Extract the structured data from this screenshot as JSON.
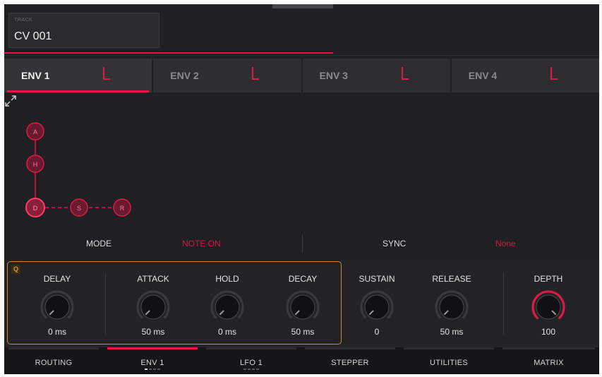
{
  "track": {
    "label": "TRACK",
    "name": "CV 001"
  },
  "env_tabs": [
    {
      "label": "ENV 1",
      "active": true
    },
    {
      "label": "ENV 2",
      "active": false
    },
    {
      "label": "ENV 3",
      "active": false
    },
    {
      "label": "ENV 4",
      "active": false
    }
  ],
  "graph": {
    "nodes": [
      "A",
      "H",
      "D",
      "S",
      "R"
    ],
    "accent": "#e0184a"
  },
  "mode": {
    "label": "MODE",
    "value": "NOTE ON"
  },
  "sync": {
    "label": "SYNC",
    "value": "None"
  },
  "q_group": {
    "badge": "Q"
  },
  "knobs": [
    {
      "label": "DELAY",
      "value": "0 ms",
      "level": 0
    },
    {
      "label": "ATTACK",
      "value": "50 ms",
      "level": 0
    },
    {
      "label": "HOLD",
      "value": "0 ms",
      "level": 0
    },
    {
      "label": "DECAY",
      "value": "50 ms",
      "level": 0
    },
    {
      "label": "SUSTAIN",
      "value": "0",
      "level": 0
    },
    {
      "label": "RELEASE",
      "value": "50 ms",
      "level": 0
    },
    {
      "label": "DEPTH",
      "value": "100",
      "level": 1
    }
  ],
  "nav": [
    {
      "label": "ROUTING",
      "active": false
    },
    {
      "label": "ENV 1",
      "active": true
    },
    {
      "label": "LFO 1",
      "active": false
    },
    {
      "label": "STEPPER",
      "active": false
    },
    {
      "label": "UTILITIES",
      "active": false
    },
    {
      "label": "MATRIX",
      "active": false
    }
  ],
  "colors": {
    "accent": "#e0184a",
    "q_outline": "#c98a2e",
    "background": "#202022"
  }
}
